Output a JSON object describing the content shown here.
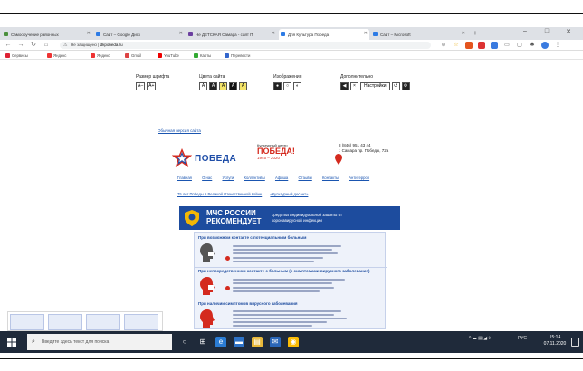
{
  "browser": {
    "tabs": [
      {
        "label": "Самообучение районных",
        "color": "#4a8f3c"
      },
      {
        "label": "Сайт – Google Диск",
        "color": "#2d7be5"
      },
      {
        "label": "Не ДЕТСКАЯ Самара - сайт П",
        "color": "#6b3fa0"
      },
      {
        "label": "Для Культура Победа",
        "color": "#2d7be5"
      },
      {
        "label": "Сайт – Microsoft",
        "color": "#2d7be5"
      }
    ],
    "new_tab": "+",
    "win_minimize": "–",
    "win_maximize": "□",
    "win_close": "✕",
    "address": {
      "prefix": "Не защищено |",
      "url": "dkpobeda.ru"
    },
    "bookmarks": [
      {
        "label": "Сервисы",
        "color": "#d23"
      },
      {
        "label": "Яндекс",
        "color": "#e33"
      },
      {
        "label": "Яндекс",
        "color": "#e33"
      },
      {
        "label": "Gmail",
        "color": "#d44"
      },
      {
        "label": "YouTube",
        "color": "#e00"
      },
      {
        "label": "Карты",
        "color": "#3a3"
      },
      {
        "label": "Перевести",
        "color": "#36c"
      }
    ]
  },
  "page": {
    "a11y": {
      "font_size_title": "Размер шрифта",
      "font_size_btns": [
        "A–",
        "A+"
      ],
      "colors_title": "Цвета сайта",
      "colors_btns": [
        "A",
        "A",
        "A",
        "A",
        "A"
      ],
      "images_title": "Изображения",
      "extra_title": "Дополнительно",
      "extra_btn": "Настройки"
    },
    "top_links": [
      "Обычная версия сайта"
    ],
    "logo_text": "ПОБЕДА",
    "center_caption": "Культурный центр",
    "center_pb": "ПОБЕДА!",
    "center_years": "1945 – 2020",
    "contacts": [
      "8 (846) 951 43 44",
      "г. Самара пр. Победы, 72а"
    ],
    "menu": [
      "Главная",
      "О нас",
      "Услуги",
      "Коллективы",
      "Афиша",
      "Отзывы",
      "Контакты",
      "Антитеррор"
    ],
    "submenu": [
      "75 лет Победы в Великой Отечественной войне",
      "«Культурный десант»"
    ],
    "banner": {
      "line1": "МЧС РОССИИ",
      "line2": "РЕКОМЕНДУЕТ",
      "side": "средства индивидуальной защиты от коронавирусной инфекции"
    },
    "sections": [
      "При возможном контакте с потенциальным больным",
      "При непосредственном контакте с больным (с симптомами вирусного заболевания)",
      "При наличии симптомов вирусного заболевания"
    ]
  },
  "taskbar": {
    "search_placeholder": "Введите здесь текст для поиска",
    "tray_text": "РУС",
    "time": "15:14",
    "date": "07.11.2020"
  }
}
